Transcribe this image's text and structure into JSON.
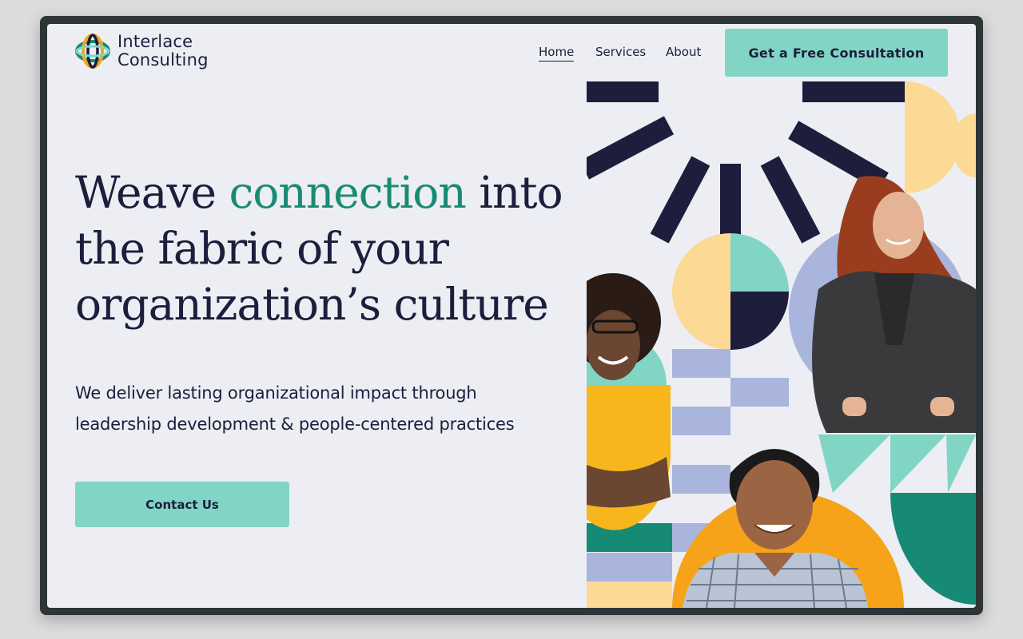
{
  "header": {
    "logo_line1": "Interlace",
    "logo_line2": "Consulting",
    "nav": {
      "home": "Home",
      "services": "Services",
      "about": "About"
    },
    "cta_label": "Get a Free Consultation"
  },
  "hero": {
    "title_part1": "Weave ",
    "title_accent": "connection",
    "title_part2": " into the fabric of your organization’s culture",
    "subtitle": "We deliver lasting organizational impact through leadership development & people-centered practices",
    "contact_label": "Contact Us"
  },
  "colors": {
    "background": "#eceef3",
    "navy": "#1d1d3c",
    "accent_green": "#1a8a74",
    "mint": "#81d5c5",
    "yellow": "#fcd995",
    "orange": "#f6a31a",
    "lavender": "#a9b5dc",
    "teal": "#168a74"
  },
  "icons": [
    "interlace-logo-icon",
    "person-photo-1",
    "person-photo-2",
    "person-photo-3"
  ]
}
